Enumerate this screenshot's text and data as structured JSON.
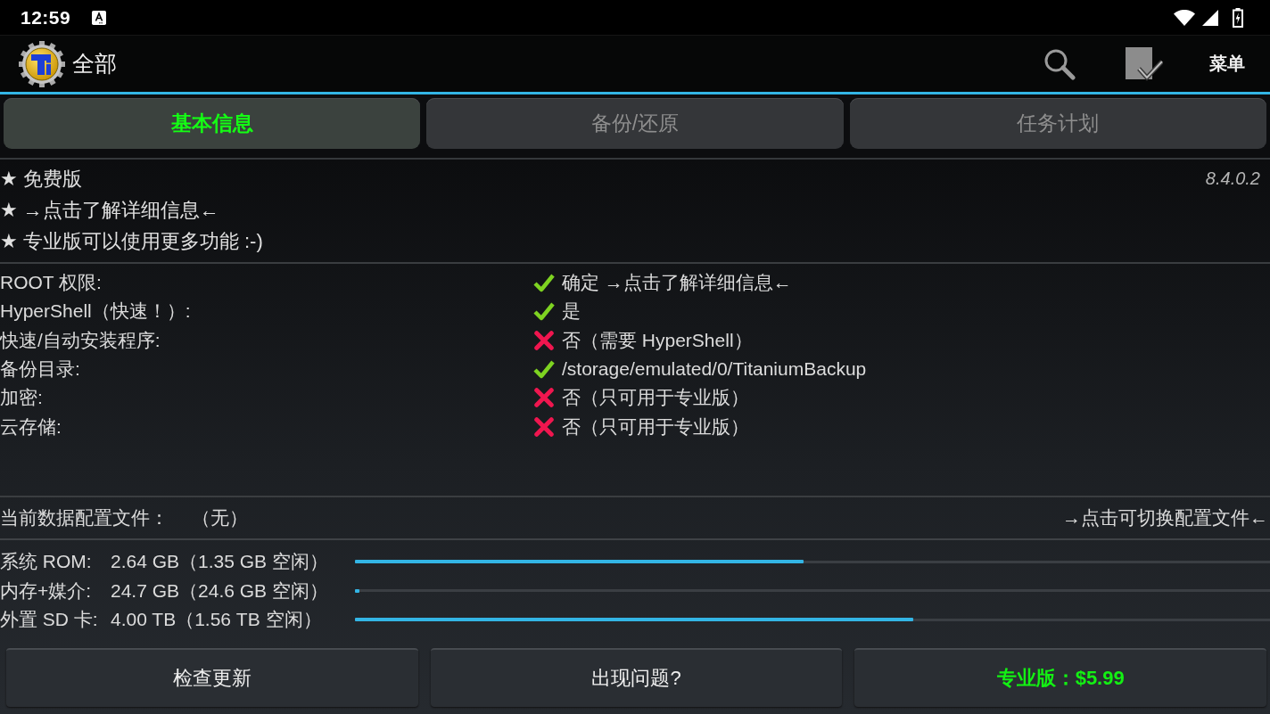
{
  "status_bar": {
    "time": "12:59"
  },
  "action_bar": {
    "title": "全部",
    "menu": "菜单"
  },
  "tabs": [
    {
      "label": "基本信息",
      "selected": true
    },
    {
      "label": "备份/还原",
      "selected": false
    },
    {
      "label": "任务计划",
      "selected": false
    }
  ],
  "info": {
    "lines": [
      "★ 免费版",
      "★ →点击了解详细信息←",
      "★ 专业版可以使用更多功能 :-)"
    ],
    "version": "8.4.0.2"
  },
  "status": [
    {
      "label": "ROOT 权限:",
      "ok": true,
      "value": "确定 →点击了解详细信息←"
    },
    {
      "label": "HyperShell（快速！）:",
      "ok": true,
      "value": "是"
    },
    {
      "label": "快速/自动安装程序:",
      "ok": false,
      "value": "否（需要 HyperShell）"
    },
    {
      "label": "备份目录:",
      "ok": true,
      "value": "/storage/emulated/0/TitaniumBackup"
    },
    {
      "label": "加密:",
      "ok": false,
      "value": "否（只可用于专业版）"
    },
    {
      "label": "云存储:",
      "ok": false,
      "value": "否（只可用于专业版）"
    }
  ],
  "profile": {
    "label": "当前数据配置文件：",
    "value": "（无）",
    "switch_link": "→点击可切换配置文件←"
  },
  "storage": [
    {
      "label": "系统 ROM:",
      "reading": "2.64 GB（1.35 GB 空闲）",
      "level": 0.49
    },
    {
      "label": "内存+媒介:",
      "reading": "24.7 GB（24.6 GB 空闲）",
      "level": 0.005
    },
    {
      "label": "外置 SD 卡:",
      "reading": "4.00 TB（1.56 TB 空闲）",
      "level": 0.61
    }
  ],
  "buttons": [
    {
      "label": "检查更新",
      "kind": "normal"
    },
    {
      "label": "出现问题?",
      "kind": "normal"
    },
    {
      "label": "专业版：$5.99",
      "kind": "pro"
    }
  ]
}
